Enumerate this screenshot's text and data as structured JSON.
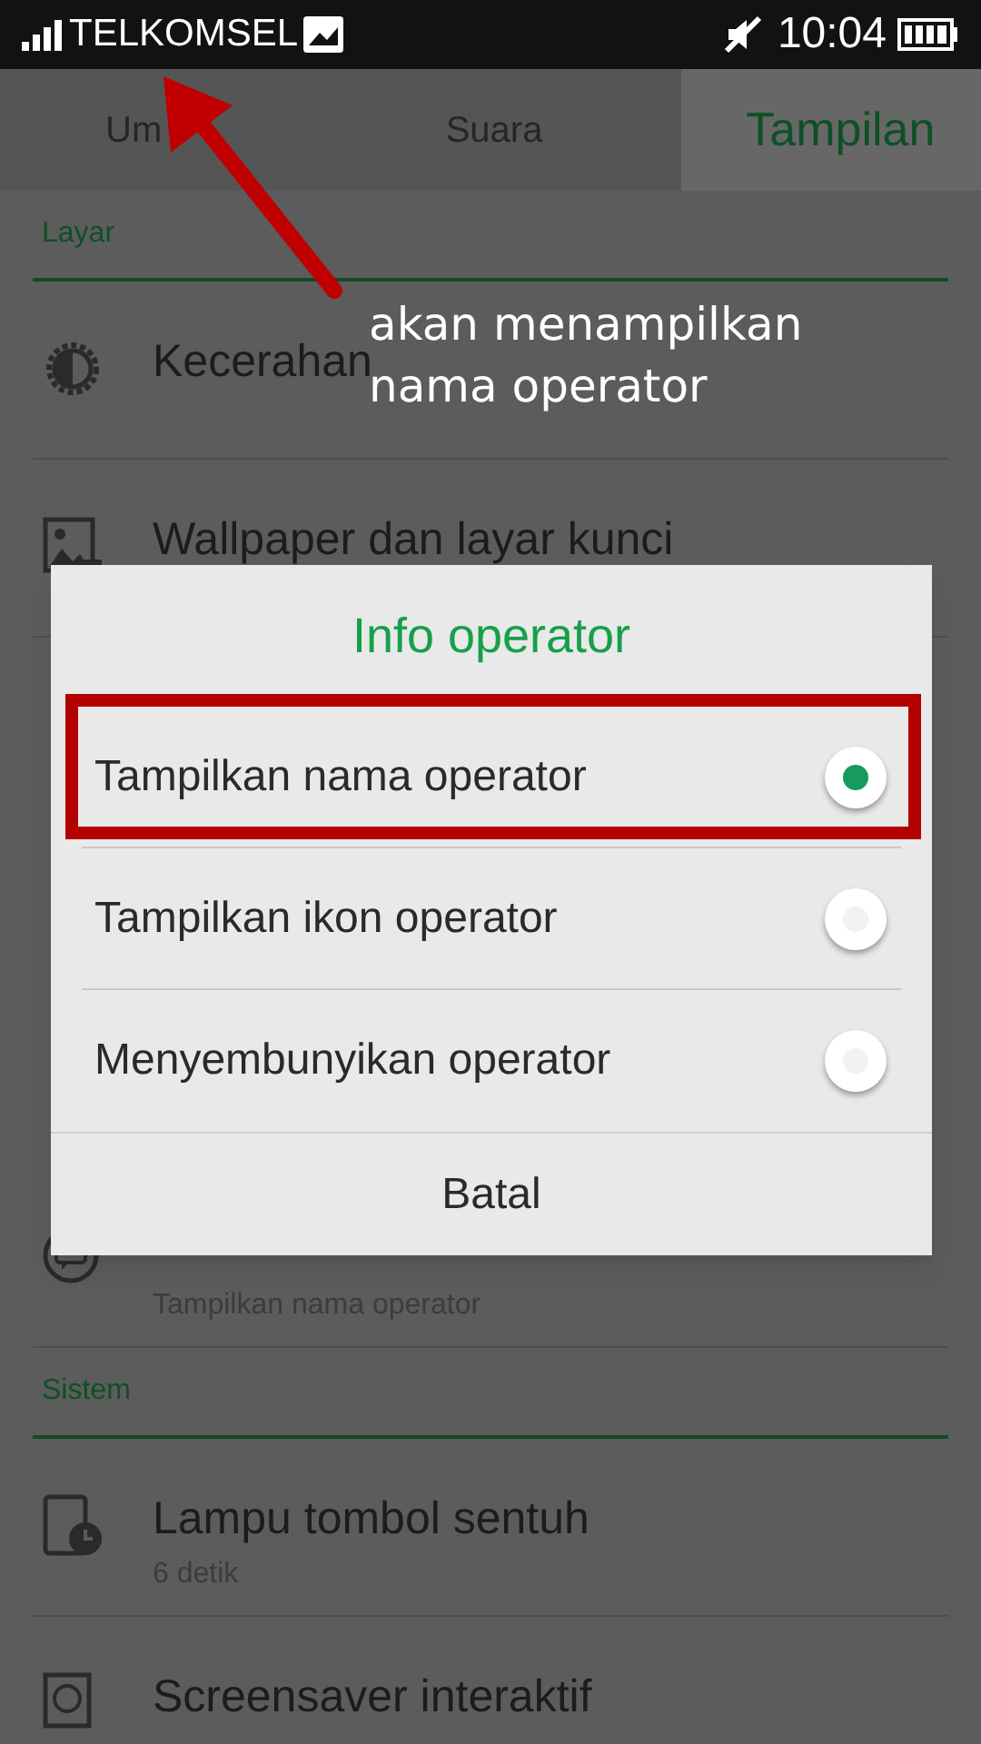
{
  "status_bar": {
    "carrier": "TELKOMSEL",
    "time": "10:04"
  },
  "tabs": [
    {
      "label": "Um",
      "selected": false
    },
    {
      "label": "Suara",
      "selected": false
    },
    {
      "label": "Tampilan",
      "selected": true
    }
  ],
  "sections": [
    {
      "title": "Layar",
      "items": [
        {
          "kind": "brightness",
          "title": "Kecerahan"
        },
        {
          "kind": "wallpaper",
          "title": "Wallpaper dan layar kunci"
        },
        {
          "kind": "gap"
        },
        {
          "kind": "operator",
          "subtitle": "Tampilkan nama operator"
        }
      ]
    },
    {
      "title": "Sistem",
      "items": [
        {
          "kind": "keylight",
          "title": "Lampu tombol sentuh",
          "subtitle": "6 detik"
        },
        {
          "kind": "screensaver",
          "title": "Screensaver interaktif"
        }
      ]
    }
  ],
  "dialog": {
    "title": "Info operator",
    "options": [
      {
        "label": "Tampilkan nama operator",
        "selected": true
      },
      {
        "label": "Tampilkan ikon operator",
        "selected": false
      },
      {
        "label": "Menyembunyikan operator",
        "selected": false
      }
    ],
    "cancel": "Batal"
  },
  "annotation": {
    "text": "akan menampilkan nama operator"
  }
}
